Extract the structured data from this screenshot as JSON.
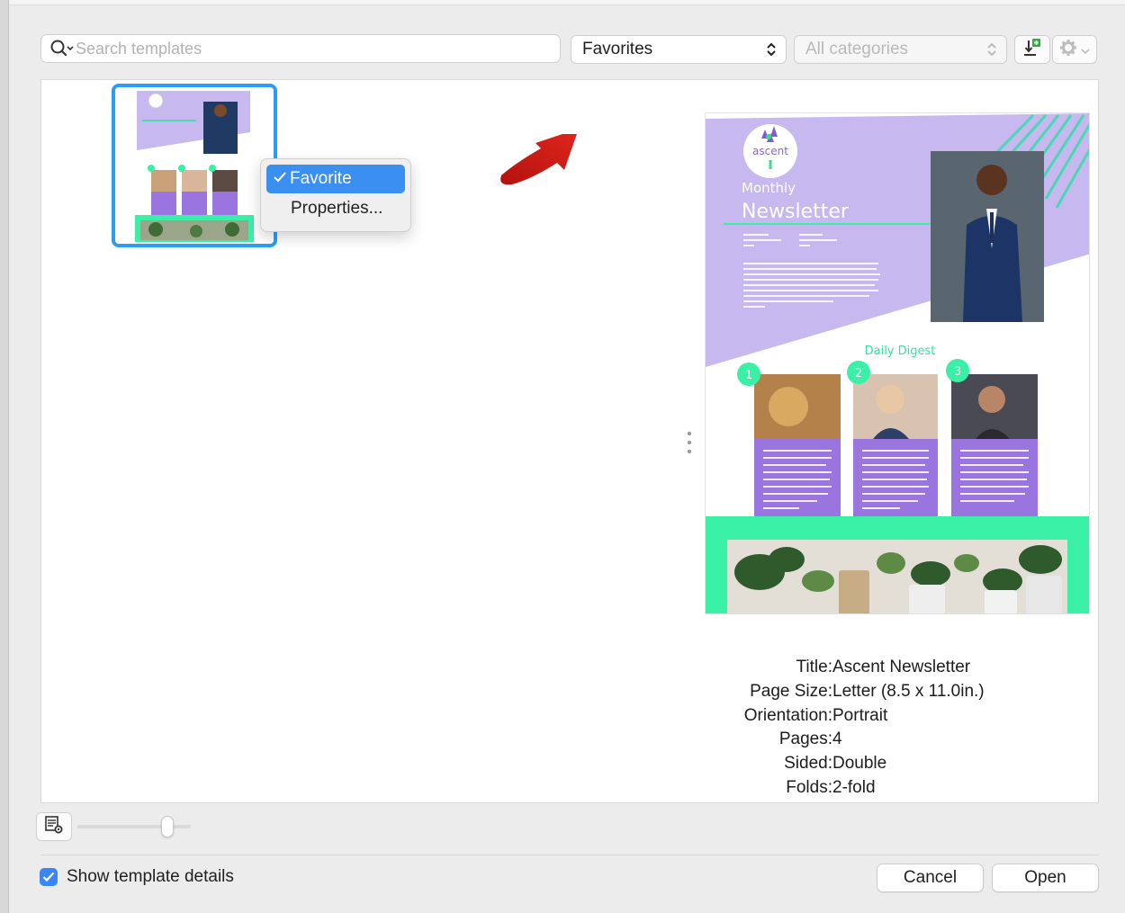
{
  "toolbar": {
    "search_placeholder": "Search templates",
    "filter_selected": "Favorites",
    "category_selected": "All categories"
  },
  "context_menu": {
    "items": [
      {
        "label": "Favorite",
        "checked": true
      },
      {
        "label": "Properties...",
        "checked": false
      }
    ]
  },
  "preview": {
    "brand": "ascent",
    "kicker": "Monthly",
    "headline": "Newsletter",
    "section": "Daily Digest",
    "steps": [
      "1",
      "2",
      "3"
    ],
    "colors": {
      "lavender": "#c7b8ef",
      "purple": "#9a74df",
      "mint": "#39f0a6",
      "teal": "#47d9b4"
    }
  },
  "details": [
    {
      "key": "Title:",
      "value": "Ascent Newsletter"
    },
    {
      "key": "Page Size:",
      "value": "Letter (8.5 x 11.0in.)"
    },
    {
      "key": "Orientation:",
      "value": "Portrait"
    },
    {
      "key": "Pages:",
      "value": "4"
    },
    {
      "key": "Sided:",
      "value": "Double"
    },
    {
      "key": "Folds:",
      "value": "2-fold"
    }
  ],
  "footer": {
    "show_details_label": "Show template details",
    "show_details_checked": true,
    "cancel_label": "Cancel",
    "open_label": "Open"
  },
  "icons": [
    "search-icon",
    "chevron-updown-icon",
    "import-template-icon",
    "gear-icon",
    "view-options-icon",
    "checkmark-icon",
    "red-annotation-arrow"
  ]
}
